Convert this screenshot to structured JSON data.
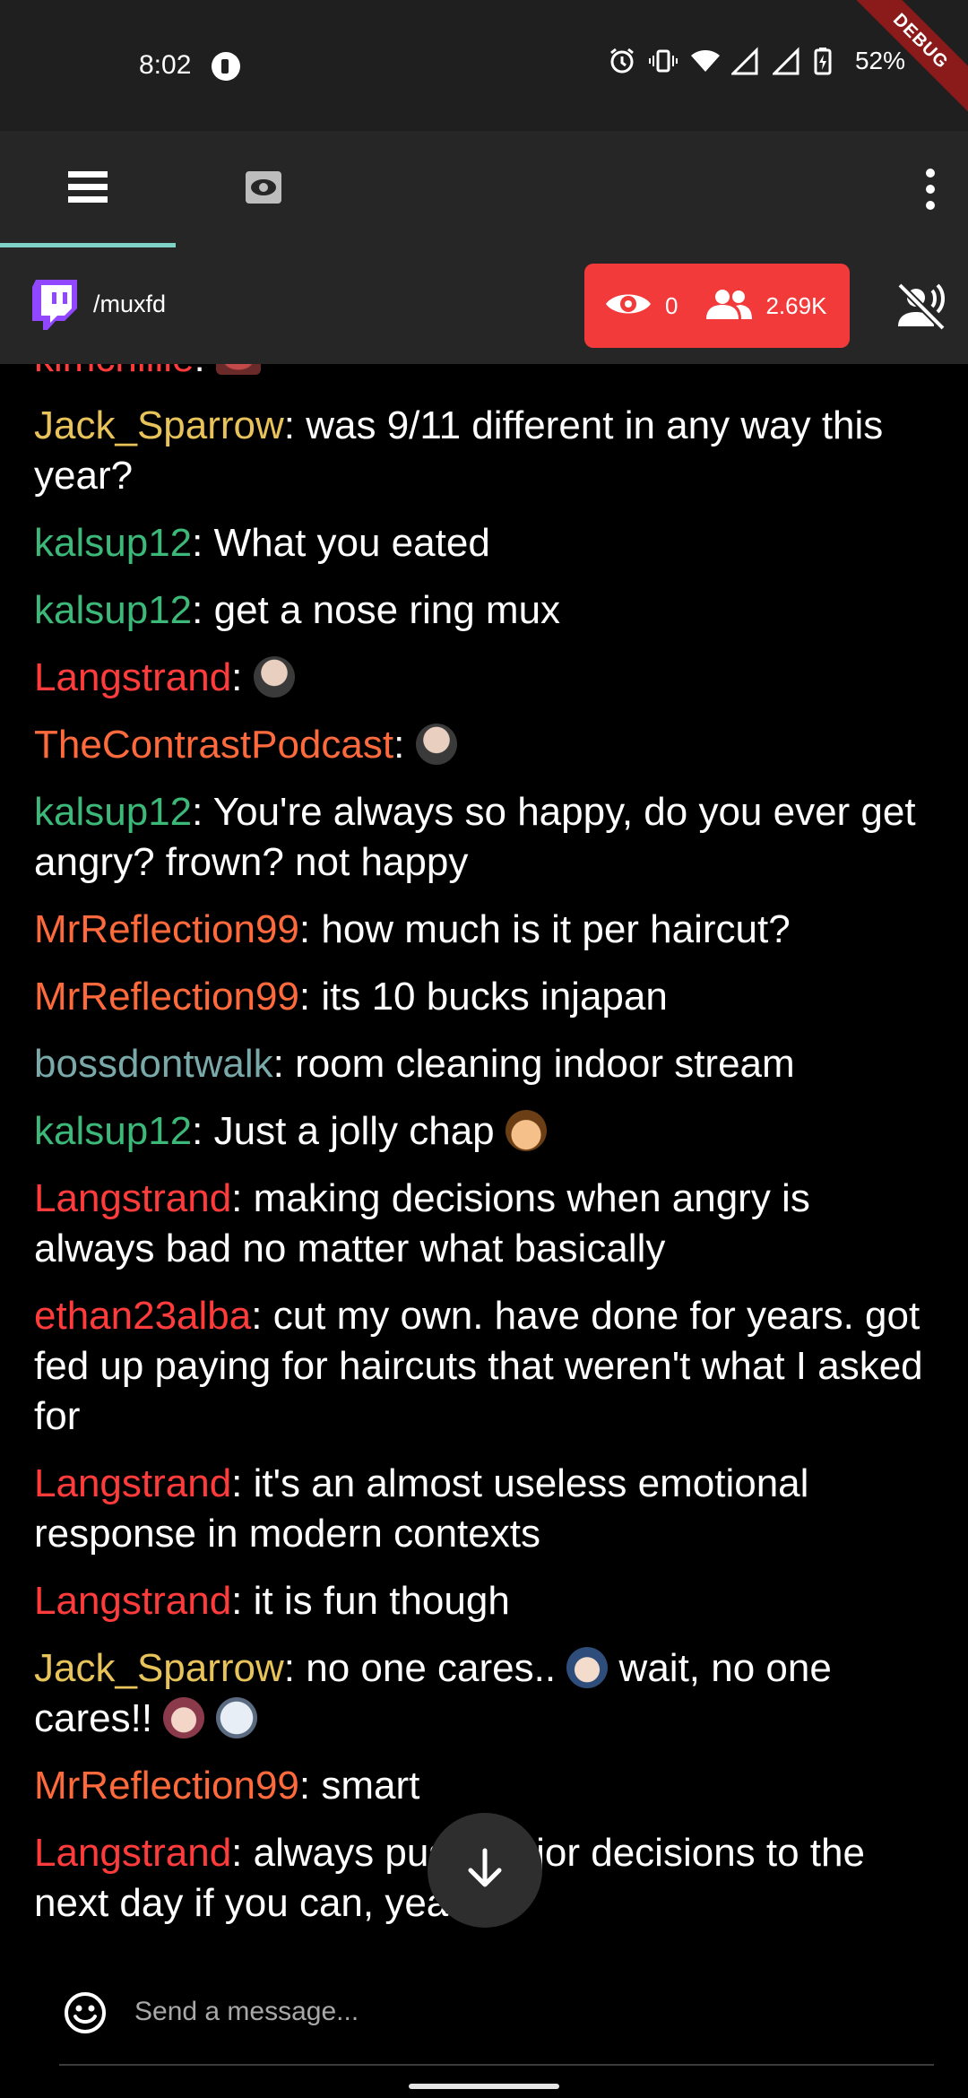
{
  "status_bar": {
    "time": "8:02",
    "battery_percent": "52%",
    "icons": [
      "alarm-icon",
      "vibrate-icon",
      "wifi-icon",
      "signal-icon",
      "battery-icon"
    ],
    "debug_label": "DEBUG"
  },
  "tabs": [
    {
      "name": "chat-tab",
      "icon": "list-icon",
      "selected": true
    },
    {
      "name": "stream-tab",
      "icon": "eye-screen-icon",
      "selected": false
    }
  ],
  "channel": {
    "name": "/muxfd",
    "viewers_current": "0",
    "followers": "2.69K"
  },
  "colors": {
    "accent": "#7fd3c6",
    "stats_pill": "#f23a3a",
    "red_user": "#ff3b3b",
    "orange_user": "#ff6a3d",
    "gold_user": "#e8c35a",
    "green_user": "#3cb878",
    "teal_user": "#7aa9aa"
  },
  "messages": [
    {
      "user": "kimchiiiie",
      "color": "#ff3b3b",
      "text": "",
      "emotes": [
        "lips"
      ]
    },
    {
      "user": "Jack_Sparrow",
      "color": "#e8c35a",
      "text": "was 9/11 different in any way this year?"
    },
    {
      "user": "kalsup12",
      "color": "#3cb878",
      "text": "What you eated"
    },
    {
      "user": "kalsup12",
      "color": "#3cb878",
      "text": "get a nose ring mux"
    },
    {
      "user": "Langstrand",
      "color": "#ff3b3b",
      "text": "",
      "emotes": [
        "face"
      ]
    },
    {
      "user": "TheContrastPodcast",
      "color": "#ff6a3d",
      "text": "",
      "emotes": [
        "face"
      ]
    },
    {
      "user": "kalsup12",
      "color": "#3cb878",
      "text": "You're always so happy, do you ever get angry? frown? not happy"
    },
    {
      "user": "MrReflection99",
      "color": "#ff6a3d",
      "text": "how much is it per haircut?"
    },
    {
      "user": "MrReflection99",
      "color": "#ff6a3d",
      "text": "its 10 bucks injapan"
    },
    {
      "user": "bossdontwalk",
      "color": "#7aa9aa",
      "text": "room cleaning indoor stream"
    },
    {
      "user": "kalsup12",
      "color": "#3cb878",
      "text": "Just a jolly chap",
      "emotes": [
        "boy"
      ]
    },
    {
      "user": "Langstrand",
      "color": "#ff3b3b",
      "text": "making decisions when angry is always bad no matter what basically"
    },
    {
      "user": "ethan23alba",
      "color": "#ff3b3b",
      "text": "cut my own.  have done for years. got fed up paying for haircuts that weren't what I asked for"
    },
    {
      "user": "Langstrand",
      "color": "#ff3b3b",
      "text": "it's an almost useless emotional response in modern contexts"
    },
    {
      "user": "Langstrand",
      "color": "#ff3b3b",
      "text": "it is fun though"
    },
    {
      "user": "Jack_Sparrow",
      "color": "#e8c35a",
      "text": "no one cares..",
      "emotes_mid": [
        "anime"
      ],
      "text2": "wait, no one cares!!",
      "emotes": [
        "girl",
        "mask"
      ]
    },
    {
      "user": "MrReflection99",
      "color": "#ff6a3d",
      "text": "smart"
    },
    {
      "user": "Langstrand",
      "color": "#ff3b3b",
      "text": "always push major decisions to the next day if you can, yeah"
    }
  ],
  "input": {
    "placeholder": "Send a message..."
  }
}
